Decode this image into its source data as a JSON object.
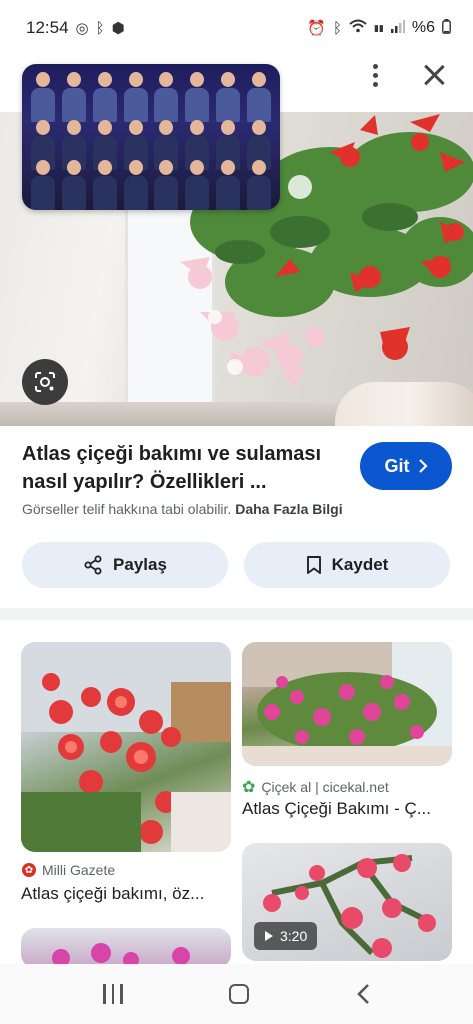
{
  "status_bar": {
    "time": "12:54",
    "battery": "%6"
  },
  "result": {
    "title": "Atlas çiçeği bakımı ve sulaması nasıl yapılır? Özellikleri ...",
    "go_label": "Git",
    "copyright": "Görseller telif hakkına tabi olabilir.",
    "more_info": "Daha Fazla Bilgi",
    "share_label": "Paylaş",
    "save_label": "Kaydet"
  },
  "related": [
    {
      "source": "Milli Gazete",
      "title": "Atlas çiçeği bakımı, öz..."
    },
    {
      "source": "Çiçek al | cicekal.net",
      "title": "Atlas Çiçeği Bakımı - Ç..."
    },
    {
      "duration": "3:20"
    }
  ],
  "colors": {
    "accent": "#0b57d0",
    "chip_bg": "#e8eef8"
  }
}
